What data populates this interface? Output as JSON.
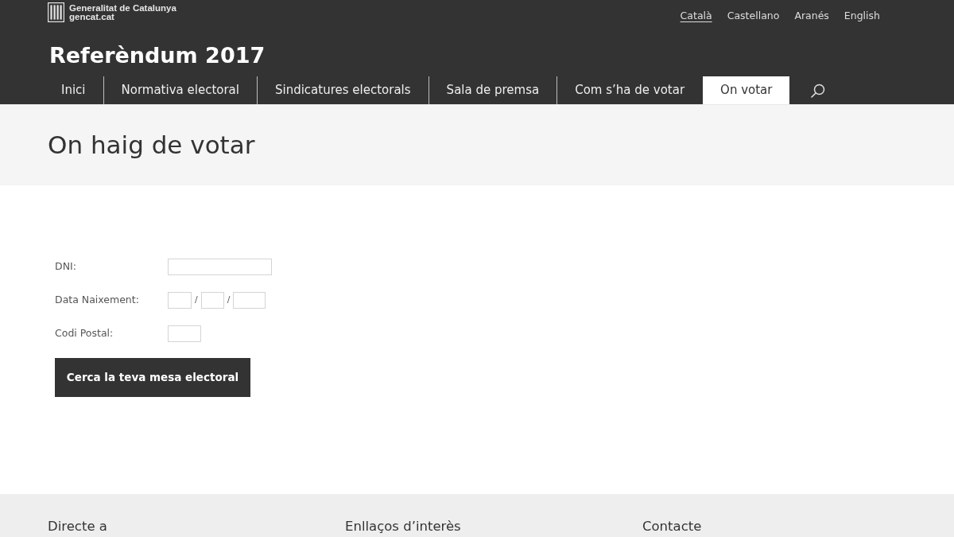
{
  "header": {
    "logo": {
      "line_1": "Generalitat de Catalunya",
      "line_2": "gencat.cat"
    },
    "languages": [
      {
        "label": "Català",
        "selected": true
      },
      {
        "label": "Castellano",
        "selected": false
      },
      {
        "label": "Aranés",
        "selected": false
      },
      {
        "label": "English",
        "selected": false
      }
    ],
    "site_title": "Referèndum 2017",
    "nav": [
      {
        "label": "Inici",
        "selected": false
      },
      {
        "label": "Normativa electoral",
        "selected": false
      },
      {
        "label": "Sindicatures electorals",
        "selected": false
      },
      {
        "label": "Sala de premsa",
        "selected": false
      },
      {
        "label": "Com s’ha de votar",
        "selected": false
      },
      {
        "label": "On votar",
        "selected": true
      }
    ]
  },
  "page_title": "On haig de votar",
  "form": {
    "fields": [
      {
        "label": "DNI:",
        "kind": "text"
      },
      {
        "label": "Data Naixement:",
        "kind": "date",
        "separators": [
          "/",
          "/"
        ]
      },
      {
        "label": "Codi Postal:",
        "kind": "short"
      }
    ],
    "submit": "Cerca la teva mesa electoral"
  },
  "footer": {
    "columns": [
      "Directe a",
      "Enllaços d’interès",
      "Contacte"
    ]
  }
}
